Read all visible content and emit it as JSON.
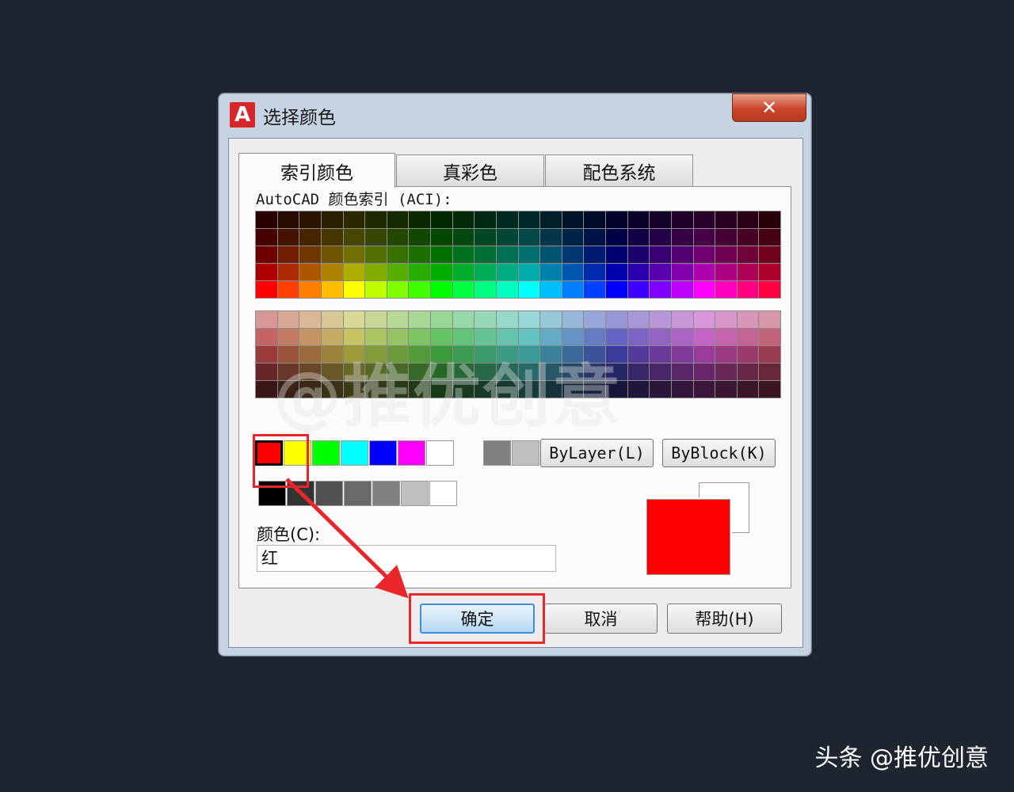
{
  "window": {
    "title": "选择颜色",
    "close_glyph": "✕",
    "logo_letter": "A"
  },
  "tabs": [
    {
      "label": "索引颜色",
      "active": true
    },
    {
      "label": "真彩色",
      "active": false
    },
    {
      "label": "配色系统",
      "active": false
    }
  ],
  "aci_label": "AutoCAD 颜色索引 (ACI):",
  "standard_colors": [
    "#ff0000",
    "#ffff00",
    "#00ff00",
    "#00ffff",
    "#0000ff",
    "#ff00ff",
    "#ffffff",
    "#808080",
    "#c0c0c0"
  ],
  "gray_colors": [
    "#000000",
    "#333333",
    "#505050",
    "#696969",
    "#808080",
    "#bebebe",
    "#ffffff"
  ],
  "buttons": {
    "bylayer": "ByLayer(L)",
    "byblock": "ByBlock(K)",
    "ok": "确定",
    "cancel": "取消",
    "help": "帮助(H)"
  },
  "color_field": {
    "label": "颜色(C):",
    "value": "红"
  },
  "preview": {
    "new_color": "#ff0000",
    "old_color": "#ffffff"
  },
  "watermark": "@推优创意",
  "credit": "头条 @推优创意"
}
